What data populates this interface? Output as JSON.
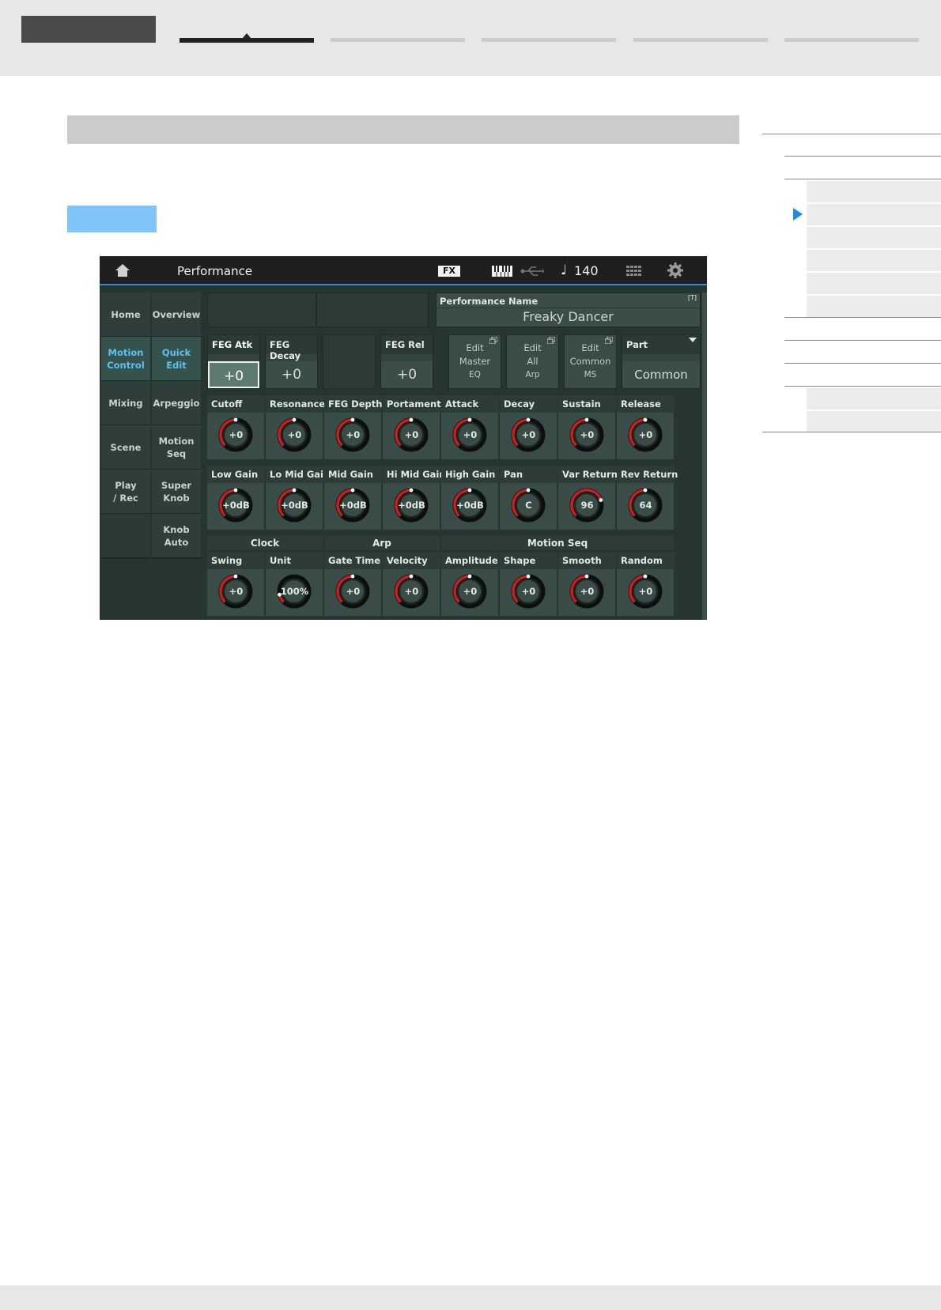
{
  "screen": {
    "title": "Performance",
    "fx": "FX",
    "tempo": "140",
    "note_glyph": "♩",
    "menu_left": [
      "Home",
      "Motion\nControl",
      "Mixing",
      "Scene",
      "Play\n/ Rec",
      ""
    ],
    "menu_left_active": 1,
    "menu_right": [
      "Overview",
      "Quick\nEdit",
      "Arpeggio",
      "Motion\nSeq",
      "Super\nKnob",
      "Knob\nAuto"
    ],
    "menu_right_active": 1,
    "performance_name_label": "Performance Name",
    "performance_name_icon": "[T]",
    "performance_name": "Freaky Dancer",
    "feg_boxes": [
      {
        "label": "FEG Atk",
        "value": "+0"
      },
      {
        "label": "FEG Decay",
        "value": "+0"
      },
      {
        "label": "FEG Rel",
        "value": "+0"
      }
    ],
    "edit_buttons": [
      {
        "line1": "Edit",
        "line2": "Master",
        "line3": "EQ"
      },
      {
        "line1": "Edit",
        "line2": "All",
        "line3": "Arp"
      },
      {
        "line1": "Edit",
        "line2": "Common",
        "line3": "MS"
      }
    ],
    "part_label": "Part",
    "part_value": "Common",
    "knob_row1": [
      {
        "label": "Cutoff",
        "value": "+0",
        "level": 0.5
      },
      {
        "label": "Resonance",
        "value": "+0",
        "level": 0.5
      },
      {
        "label": "FEG Depth",
        "value": "+0",
        "level": 0.5
      },
      {
        "label": "Portamento",
        "value": "+0",
        "level": 0.5
      },
      {
        "label": "Attack",
        "value": "+0",
        "level": 0.5
      },
      {
        "label": "Decay",
        "value": "+0",
        "level": 0.5
      },
      {
        "label": "Sustain",
        "value": "+0",
        "level": 0.5
      },
      {
        "label": "Release",
        "value": "+0",
        "level": 0.5
      }
    ],
    "knob_row2": [
      {
        "label": "Low Gain",
        "value": "+0dB",
        "level": 0.5
      },
      {
        "label": "Lo Mid Gain",
        "value": "+0dB",
        "level": 0.5
      },
      {
        "label": "Mid Gain",
        "value": "+0dB",
        "level": 0.5
      },
      {
        "label": "Hi Mid Gain",
        "value": "+0dB",
        "level": 0.5
      },
      {
        "label": "High Gain",
        "value": "+0dB",
        "level": 0.5
      },
      {
        "label": "Pan",
        "value": "C",
        "level": 0.5
      },
      {
        "label": "Var Return",
        "value": "96",
        "level": 0.76
      },
      {
        "label": "Rev Return",
        "value": "64",
        "level": 0.5
      }
    ],
    "group_labels": [
      "Clock",
      "Arp",
      "Motion Seq"
    ],
    "knob_row3": [
      {
        "label": "Swing",
        "value": "+0",
        "level": 0.5
      },
      {
        "label": "Unit",
        "value": "100%",
        "level": 0.12
      },
      {
        "label": "Gate Time",
        "value": "+0",
        "level": 0.5
      },
      {
        "label": "Velocity",
        "value": "+0",
        "level": 0.5
      },
      {
        "label": "Amplitude",
        "value": "+0",
        "level": 0.5
      },
      {
        "label": "Shape",
        "value": "+0",
        "level": 0.5
      },
      {
        "label": "Smooth",
        "value": "+0",
        "level": 0.5
      },
      {
        "label": "Random",
        "value": "+0",
        "level": 0.5
      }
    ],
    "colors": {
      "knob_arc": "#c8201f",
      "accent_blue": "#5bc2f2",
      "title_line": "#2f8ad8"
    }
  }
}
